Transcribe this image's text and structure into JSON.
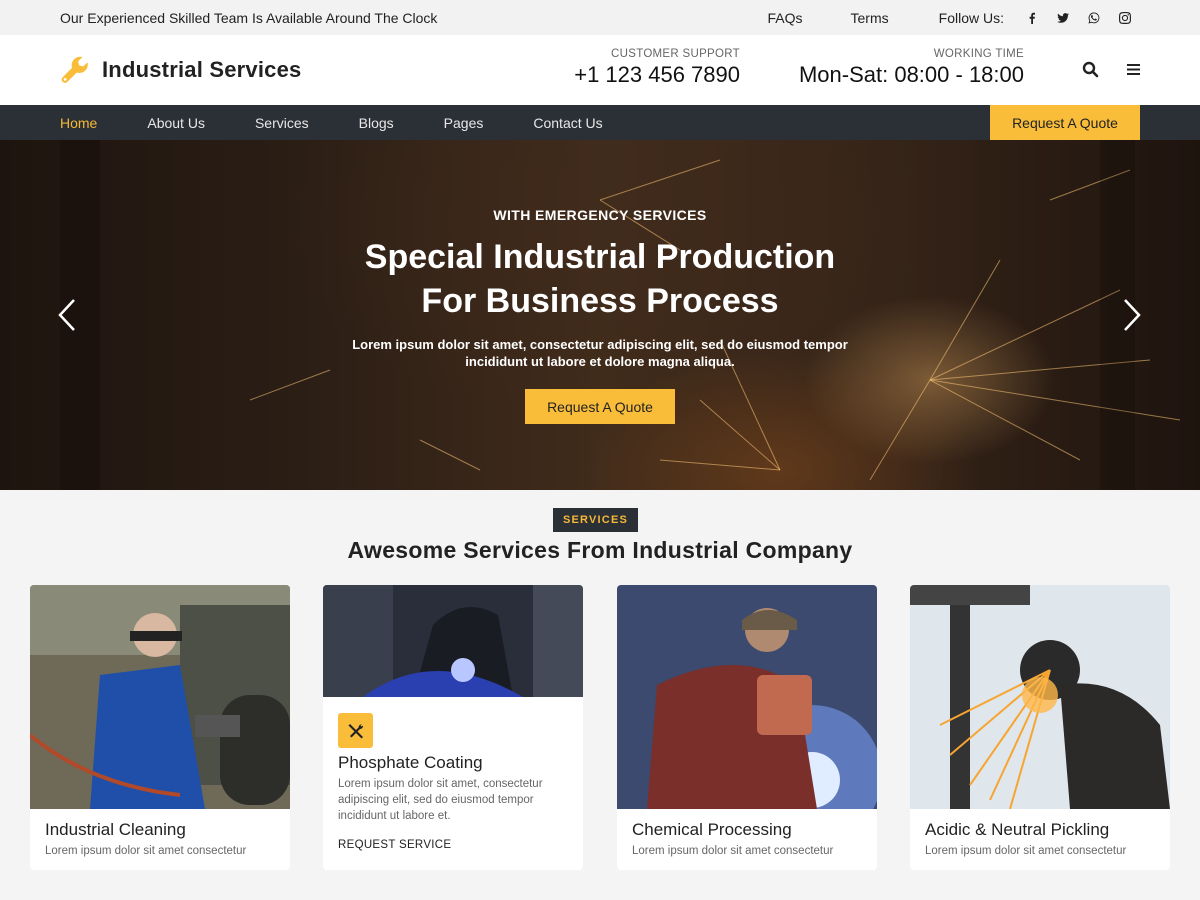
{
  "topbar": {
    "tagline": "Our Experienced Skilled Team Is Available Around The Clock",
    "faqs": "FAQs",
    "terms": "Terms",
    "follow": "Follow Us:",
    "social_icons": [
      "facebook-icon",
      "twitter-icon",
      "whatsapp-icon",
      "instagram-icon"
    ]
  },
  "header": {
    "logo_icon": "wrench-icon",
    "site_name": "Industrial Services",
    "support_label": "CUSTOMER SUPPORT",
    "support_phone": "+1 123 456 7890",
    "working_label": "WORKING TIME",
    "working_hours": "Mon-Sat: 08:00 - 18:00"
  },
  "nav": {
    "items": [
      "Home",
      "About Us",
      "Services",
      "Blogs",
      "Pages",
      "Contact Us"
    ],
    "active": "Home",
    "quote": "Request A Quote"
  },
  "hero": {
    "eyebrow": "WITH EMERGENCY SERVICES",
    "title_line1": "Special Industrial Production",
    "title_line2": "For Business Process",
    "lead_line1": "Lorem ipsum dolor sit amet, consectetur adipiscing elit, sed do eiusmod tempor",
    "lead_line2": "incididunt ut labore et dolore magna aliqua.",
    "cta": "Request A Quote"
  },
  "services": {
    "badge": "SERVICES",
    "title": "Awesome Services From Industrial Company",
    "cards": [
      {
        "title": "Industrial Cleaning",
        "desc": "Lorem ipsum dolor sit amet consectetur"
      },
      {
        "title": "Phosphate Coating",
        "desc": "Lorem ipsum dolor sit amet, consectetur adipiscing elit, sed do eiusmod tempor incididunt ut labore et.",
        "link": "REQUEST SERVICE",
        "icon": "tools-icon"
      },
      {
        "title": "Chemical Processing",
        "desc": "Lorem ipsum dolor sit amet consectetur"
      },
      {
        "title": "Acidic & Neutral Pickling",
        "desc": "Lorem ipsum dolor sit amet consectetur"
      }
    ]
  },
  "colors": {
    "accent": "#f9bd3a",
    "nav_bg": "#2b2f36",
    "active_nav": "#f5b937"
  }
}
